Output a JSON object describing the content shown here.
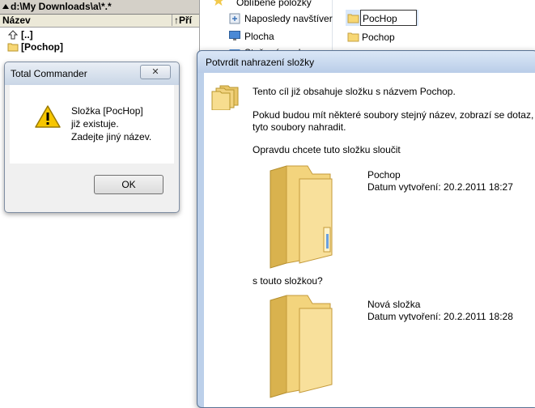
{
  "tc_panel": {
    "path": "d:\\My Downloads\\a\\*.*",
    "col_name": "Název",
    "col_ext": "↑Pří",
    "rows": [
      {
        "icon": "up-dir-icon",
        "label": "[..]"
      },
      {
        "icon": "folder-icon",
        "label": "[Pochop]"
      }
    ]
  },
  "tc_dialog": {
    "title": "Total Commander",
    "close_label": "✕",
    "message_lines": [
      "Složka [PocHop]",
      "již existuje.",
      "Zadejte jiný název."
    ],
    "ok_label": "OK",
    "icon": "warning-icon"
  },
  "explorer": {
    "nav_items": [
      {
        "label": "Oblíbené položky",
        "icon": "star-icon"
      },
      {
        "label": "Naposledy navštíver",
        "icon": "recent-places-icon"
      },
      {
        "label": "Plocha",
        "icon": "desktop-icon"
      },
      {
        "label": "Stažené soubory",
        "icon": "downloads-icon"
      }
    ],
    "rename_value": "PocHop",
    "files": [
      {
        "label": "Pochop",
        "icon": "folder-icon"
      }
    ]
  },
  "confirm_dialog": {
    "title": "Potvrdit nahrazení složky",
    "line1": "Tento cíl již obsahuje složku s názvem Pochop.",
    "line2a": "Pokud budou mít některé soubory stejný název, zobrazí se dotaz, z",
    "line2b": "tyto soubory nahradit.",
    "question": "Opravdu chcete tuto složku sloučit",
    "existing": {
      "name": "Pochop",
      "date": "Datum vytvoření: 20.2.2011 18:27"
    },
    "with_label": "s touto složkou?",
    "new": {
      "name": "Nová složka",
      "date": "Datum vytvoření: 20.2.2011 18:28"
    }
  },
  "colors": {
    "folder_yellow": "#f4d47a",
    "warning_yellow": "#f5c400",
    "dialog_border": "#5a7394"
  }
}
